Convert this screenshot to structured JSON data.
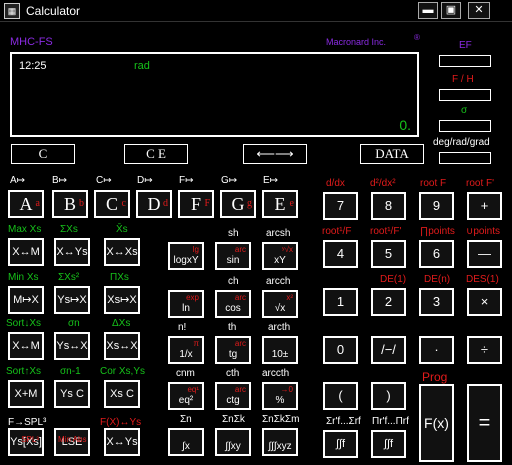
{
  "window": {
    "title": "Calculator",
    "minimize": "▬",
    "maximize": "▣",
    "close": "✕",
    "icon_glyph": "▦"
  },
  "brand_left": "MHC-FS",
  "brand_right": "Macronard Inc.",
  "brand_mark": "®",
  "display": {
    "time": "12:25",
    "angle": "rad",
    "result": "0."
  },
  "side": {
    "ef": "EF",
    "fh": "F / H",
    "sigma": "σ",
    "angle": "deg/rad/grad"
  },
  "row1": {
    "c": "C",
    "ce": "C E",
    "swap": "⟵⟶",
    "data": "DATA"
  },
  "mem_labels": [
    "A↦",
    "B↦",
    "C↦",
    "D↦",
    "F↦",
    "G↦",
    "E↦"
  ],
  "mem_keys": [
    {
      "main": "A",
      "sub": "a"
    },
    {
      "main": "B",
      "sub": "b"
    },
    {
      "main": "C",
      "sub": "c"
    },
    {
      "main": "D",
      "sub": "d"
    },
    {
      "main": "F",
      "sub": "F"
    },
    {
      "main": "G",
      "sub": "g"
    },
    {
      "main": "E",
      "sub": "e"
    }
  ],
  "green_labels": [
    "Max Xs",
    "ΣXs",
    "X̄s",
    "Min Xs",
    "ΣXs²",
    "ΠXs",
    "Sort↓Xs",
    "σn",
    "ΔXs",
    "Sort↑Xs",
    "σn-1",
    "Cor Xs,Ys"
  ],
  "stat_keys": [
    "X↔M",
    "X↔Ys",
    "X↔Xs",
    "M↦X",
    "Ys↦X",
    "Xs↦X",
    "X↔M",
    "Ys↔X",
    "Xs↔X",
    "X+M",
    "Ys C",
    "Xs C"
  ],
  "bottom_left_labels": [
    "F→SPL³",
    "",
    "F(X)↔Ys"
  ],
  "bottom_left_keys": [
    "Ys[Xs]",
    "LSE",
    "X↔Ys"
  ],
  "bottom_left_sub": [
    "SPL³",
    "Min Abs",
    ""
  ],
  "func_labels": [
    "",
    "sh",
    "arcsh",
    "",
    "ch",
    "arcch",
    "n!",
    "th",
    "arcth",
    "cnm",
    "cth",
    "arccth",
    "Σn",
    "ΣnΣk",
    "ΣnΣkΣm"
  ],
  "func_keys": [
    {
      "main": "logxY",
      "sub": "lg"
    },
    {
      "main": "sin",
      "sub": "arc"
    },
    {
      "main": "xY",
      "sub": "ʸ√x"
    },
    {
      "main": "ln",
      "sub": "exp"
    },
    {
      "main": "cos",
      "sub": "arc"
    },
    {
      "main": "√x",
      "sub": "x²"
    },
    {
      "main": "1/x",
      "sub": "π"
    },
    {
      "main": "tg",
      "sub": "arc"
    },
    {
      "main": "10±",
      "sub": ""
    },
    {
      "main": "eq²",
      "sub": "eq¹"
    },
    {
      "main": "ctg",
      "sub": "arc"
    },
    {
      "main": "%",
      "sub": "→0"
    },
    {
      "main": "∫x",
      "sub": ""
    },
    {
      "main": "∫∫xy",
      "sub": ""
    },
    {
      "main": "∫∫∫xyz",
      "sub": ""
    }
  ],
  "num_labels": [
    "d/dx",
    "d²/dx²",
    "root F",
    "root F'",
    "root¹/F",
    "root¹/F'",
    "∏points",
    "∪points",
    "",
    "DE(1)",
    "DE(n)",
    "DES(1)"
  ],
  "num_keys": [
    "7",
    "8",
    "9",
    "+",
    "4",
    "5",
    "6",
    "—",
    "1",
    "2",
    "3",
    "×",
    "0",
    "/−/",
    "·",
    "÷"
  ],
  "bottom_num_labels": [
    "Σr'f...Σrf",
    "Πr'f...Πrf",
    "Prog"
  ],
  "bottom_num_keys": [
    "(",
    ")",
    "F(x)",
    "="
  ],
  "bottom_extra": [
    "∫∫f",
    "∫∫f"
  ]
}
